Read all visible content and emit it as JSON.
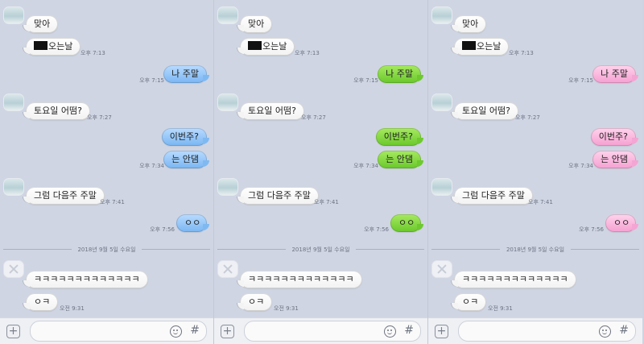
{
  "panels": [
    {
      "theme": "blue",
      "theme_color": "#7ab6f3"
    },
    {
      "theme": "green",
      "theme_color": "#6ec82c"
    },
    {
      "theme": "pink",
      "theme_color": "#f5a3d2"
    }
  ],
  "messages": {
    "m1": "맞아",
    "m2": "오는날",
    "m2_time": "오후 7:13",
    "m3": "나 주말",
    "m3_time": "오후 7:15",
    "m4": "토요일 어떰?",
    "m4_time": "오후 7:27",
    "m5": "이번주?",
    "m6": "는 안댐",
    "m6_time": "오후 7:34",
    "m7": "그럼 다음주 주말",
    "m7_time": "오후 7:41",
    "m8": "ㅇㅇ",
    "m8_time": "오후 7:56",
    "date_divider": "2018년 9월 5일 수요일",
    "m9": "ㅋㅋㅋㅋㅋㅋㅋㅋㅋㅋㅋㅋㅋ",
    "m10": "ㅇㅋ",
    "m10_time": "오전 9:31"
  },
  "input_bar": {
    "plus_glyph": "+",
    "hash_glyph": "#",
    "icons": [
      "plus-icon",
      "emoji-icon",
      "hash-icon"
    ]
  }
}
